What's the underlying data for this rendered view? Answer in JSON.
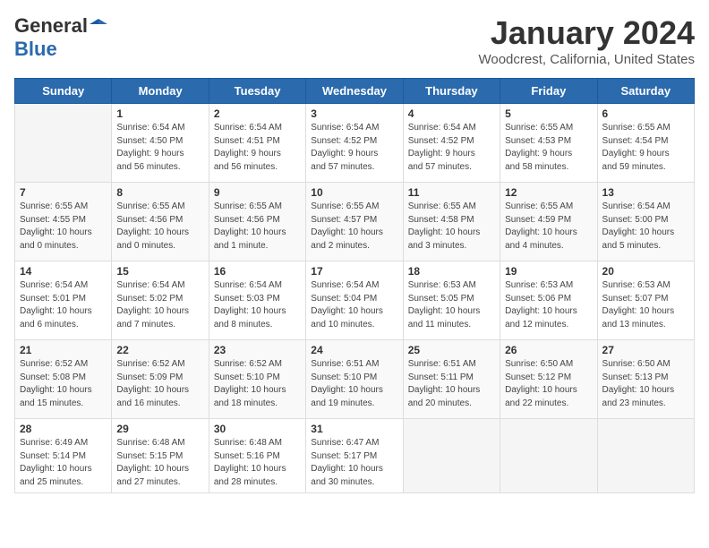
{
  "logo": {
    "general": "General",
    "blue": "Blue"
  },
  "title": "January 2024",
  "subtitle": "Woodcrest, California, United States",
  "weekdays": [
    "Sunday",
    "Monday",
    "Tuesday",
    "Wednesday",
    "Thursday",
    "Friday",
    "Saturday"
  ],
  "weeks": [
    [
      {
        "day": "",
        "info": ""
      },
      {
        "day": "1",
        "info": "Sunrise: 6:54 AM\nSunset: 4:50 PM\nDaylight: 9 hours\nand 56 minutes."
      },
      {
        "day": "2",
        "info": "Sunrise: 6:54 AM\nSunset: 4:51 PM\nDaylight: 9 hours\nand 56 minutes."
      },
      {
        "day": "3",
        "info": "Sunrise: 6:54 AM\nSunset: 4:52 PM\nDaylight: 9 hours\nand 57 minutes."
      },
      {
        "day": "4",
        "info": "Sunrise: 6:54 AM\nSunset: 4:52 PM\nDaylight: 9 hours\nand 57 minutes."
      },
      {
        "day": "5",
        "info": "Sunrise: 6:55 AM\nSunset: 4:53 PM\nDaylight: 9 hours\nand 58 minutes."
      },
      {
        "day": "6",
        "info": "Sunrise: 6:55 AM\nSunset: 4:54 PM\nDaylight: 9 hours\nand 59 minutes."
      }
    ],
    [
      {
        "day": "7",
        "info": "Sunrise: 6:55 AM\nSunset: 4:55 PM\nDaylight: 10 hours\nand 0 minutes."
      },
      {
        "day": "8",
        "info": "Sunrise: 6:55 AM\nSunset: 4:56 PM\nDaylight: 10 hours\nand 0 minutes."
      },
      {
        "day": "9",
        "info": "Sunrise: 6:55 AM\nSunset: 4:56 PM\nDaylight: 10 hours\nand 1 minute."
      },
      {
        "day": "10",
        "info": "Sunrise: 6:55 AM\nSunset: 4:57 PM\nDaylight: 10 hours\nand 2 minutes."
      },
      {
        "day": "11",
        "info": "Sunrise: 6:55 AM\nSunset: 4:58 PM\nDaylight: 10 hours\nand 3 minutes."
      },
      {
        "day": "12",
        "info": "Sunrise: 6:55 AM\nSunset: 4:59 PM\nDaylight: 10 hours\nand 4 minutes."
      },
      {
        "day": "13",
        "info": "Sunrise: 6:54 AM\nSunset: 5:00 PM\nDaylight: 10 hours\nand 5 minutes."
      }
    ],
    [
      {
        "day": "14",
        "info": "Sunrise: 6:54 AM\nSunset: 5:01 PM\nDaylight: 10 hours\nand 6 minutes."
      },
      {
        "day": "15",
        "info": "Sunrise: 6:54 AM\nSunset: 5:02 PM\nDaylight: 10 hours\nand 7 minutes."
      },
      {
        "day": "16",
        "info": "Sunrise: 6:54 AM\nSunset: 5:03 PM\nDaylight: 10 hours\nand 8 minutes."
      },
      {
        "day": "17",
        "info": "Sunrise: 6:54 AM\nSunset: 5:04 PM\nDaylight: 10 hours\nand 10 minutes."
      },
      {
        "day": "18",
        "info": "Sunrise: 6:53 AM\nSunset: 5:05 PM\nDaylight: 10 hours\nand 11 minutes."
      },
      {
        "day": "19",
        "info": "Sunrise: 6:53 AM\nSunset: 5:06 PM\nDaylight: 10 hours\nand 12 minutes."
      },
      {
        "day": "20",
        "info": "Sunrise: 6:53 AM\nSunset: 5:07 PM\nDaylight: 10 hours\nand 13 minutes."
      }
    ],
    [
      {
        "day": "21",
        "info": "Sunrise: 6:52 AM\nSunset: 5:08 PM\nDaylight: 10 hours\nand 15 minutes."
      },
      {
        "day": "22",
        "info": "Sunrise: 6:52 AM\nSunset: 5:09 PM\nDaylight: 10 hours\nand 16 minutes."
      },
      {
        "day": "23",
        "info": "Sunrise: 6:52 AM\nSunset: 5:10 PM\nDaylight: 10 hours\nand 18 minutes."
      },
      {
        "day": "24",
        "info": "Sunrise: 6:51 AM\nSunset: 5:10 PM\nDaylight: 10 hours\nand 19 minutes."
      },
      {
        "day": "25",
        "info": "Sunrise: 6:51 AM\nSunset: 5:11 PM\nDaylight: 10 hours\nand 20 minutes."
      },
      {
        "day": "26",
        "info": "Sunrise: 6:50 AM\nSunset: 5:12 PM\nDaylight: 10 hours\nand 22 minutes."
      },
      {
        "day": "27",
        "info": "Sunrise: 6:50 AM\nSunset: 5:13 PM\nDaylight: 10 hours\nand 23 minutes."
      }
    ],
    [
      {
        "day": "28",
        "info": "Sunrise: 6:49 AM\nSunset: 5:14 PM\nDaylight: 10 hours\nand 25 minutes."
      },
      {
        "day": "29",
        "info": "Sunrise: 6:48 AM\nSunset: 5:15 PM\nDaylight: 10 hours\nand 27 minutes."
      },
      {
        "day": "30",
        "info": "Sunrise: 6:48 AM\nSunset: 5:16 PM\nDaylight: 10 hours\nand 28 minutes."
      },
      {
        "day": "31",
        "info": "Sunrise: 6:47 AM\nSunset: 5:17 PM\nDaylight: 10 hours\nand 30 minutes."
      },
      {
        "day": "",
        "info": ""
      },
      {
        "day": "",
        "info": ""
      },
      {
        "day": "",
        "info": ""
      }
    ]
  ]
}
